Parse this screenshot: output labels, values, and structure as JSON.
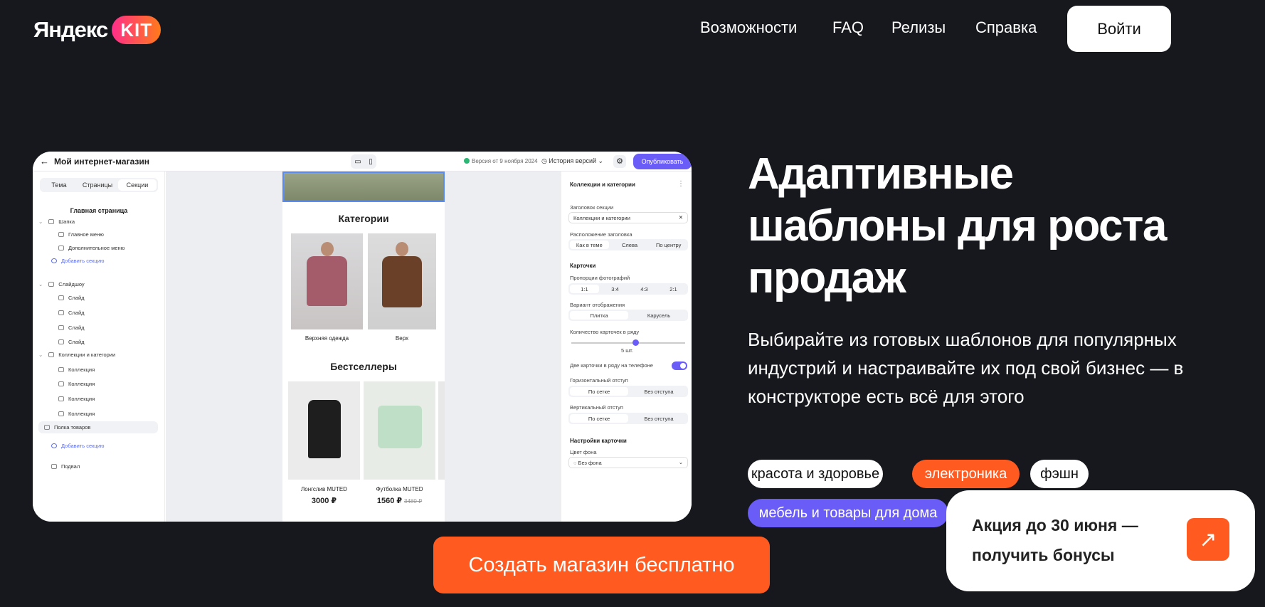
{
  "header": {
    "logo_text": "Яндекс",
    "logo_badge": "KIT",
    "nav": [
      "Возможности",
      "FAQ",
      "Релизы",
      "Справка"
    ],
    "login": "Войти"
  },
  "editor": {
    "back_icon": "arrow-left-icon",
    "title": "Мой интернет-магазин",
    "version": "Версия от 9 ноября 2024",
    "history": "История версий",
    "publish": "Опубликовать",
    "left_tabs": [
      "Тема",
      "Страницы",
      "Секции"
    ],
    "left_heading": "Главная страница",
    "tree": {
      "header": "Шапка",
      "main_menu": "Главное меню",
      "extra_menu": "Дополнительное меню",
      "add_section": "Добавить секцию",
      "slideshow": "Слайдшоу",
      "slide": "Слайд",
      "collections": "Коллекции и категории",
      "collection": "Коллекция",
      "shelf": "Полка товаров",
      "footer": "Подвал"
    },
    "preview": {
      "categories_title": "Категории",
      "cat1": "Верхняя одежда",
      "cat2": "Верх",
      "bestsellers_title": "Бестселлеры",
      "p1_name": "Лонгслив MUTED",
      "p1_price": "3000 ₽",
      "p2_name": "Футболка MUTED",
      "p2_price": "1560 ₽",
      "p2_old": "3480 ₽"
    },
    "settings": {
      "title": "Коллекции и категории",
      "section_title_label": "Заголовок секции",
      "section_title_value": "Коллекции и категории",
      "title_pos_label": "Расположение заголовка",
      "title_pos": [
        "Как в теме",
        "Слева",
        "По центру"
      ],
      "cards": "Карточки",
      "photo_ratio_label": "Пропорции фотографий",
      "photo_ratio": [
        "1:1",
        "3:4",
        "4:3",
        "2:1"
      ],
      "display_label": "Вариант отображения",
      "display": [
        "Плитка",
        "Карусель"
      ],
      "per_row_label": "Количество карточек в ряду",
      "per_row_value": "5 шт.",
      "two_on_phone": "Две карточки в ряду на телефоне",
      "hgap_label": "Горизонтальный отступ",
      "gap_opts": [
        "По сетке",
        "Без отступа"
      ],
      "vgap_label": "Вертикальный отступ",
      "card_settings": "Настройки карточки",
      "bg_color_label": "Цвет фона",
      "bg_color_value": "Без фона"
    }
  },
  "hero": {
    "title": "Адаптивные шаблоны для роста продаж",
    "subtitle": "Выбирайте из готовых шаблонов для популярных индустрий и настраивайте их под свой бизнес — в конструкторе есть всё для этого",
    "tags": [
      "красота и здоровье",
      "электроника",
      "фэшн",
      "мебель и товары для дома"
    ]
  },
  "promo": {
    "text": "Акция до 30 июня — получить бонусы"
  },
  "cta": "Создать магазин бесплатно",
  "colors": {
    "background": "#17181d",
    "accent": "#ff5b21",
    "purple": "#6a5cf6"
  }
}
